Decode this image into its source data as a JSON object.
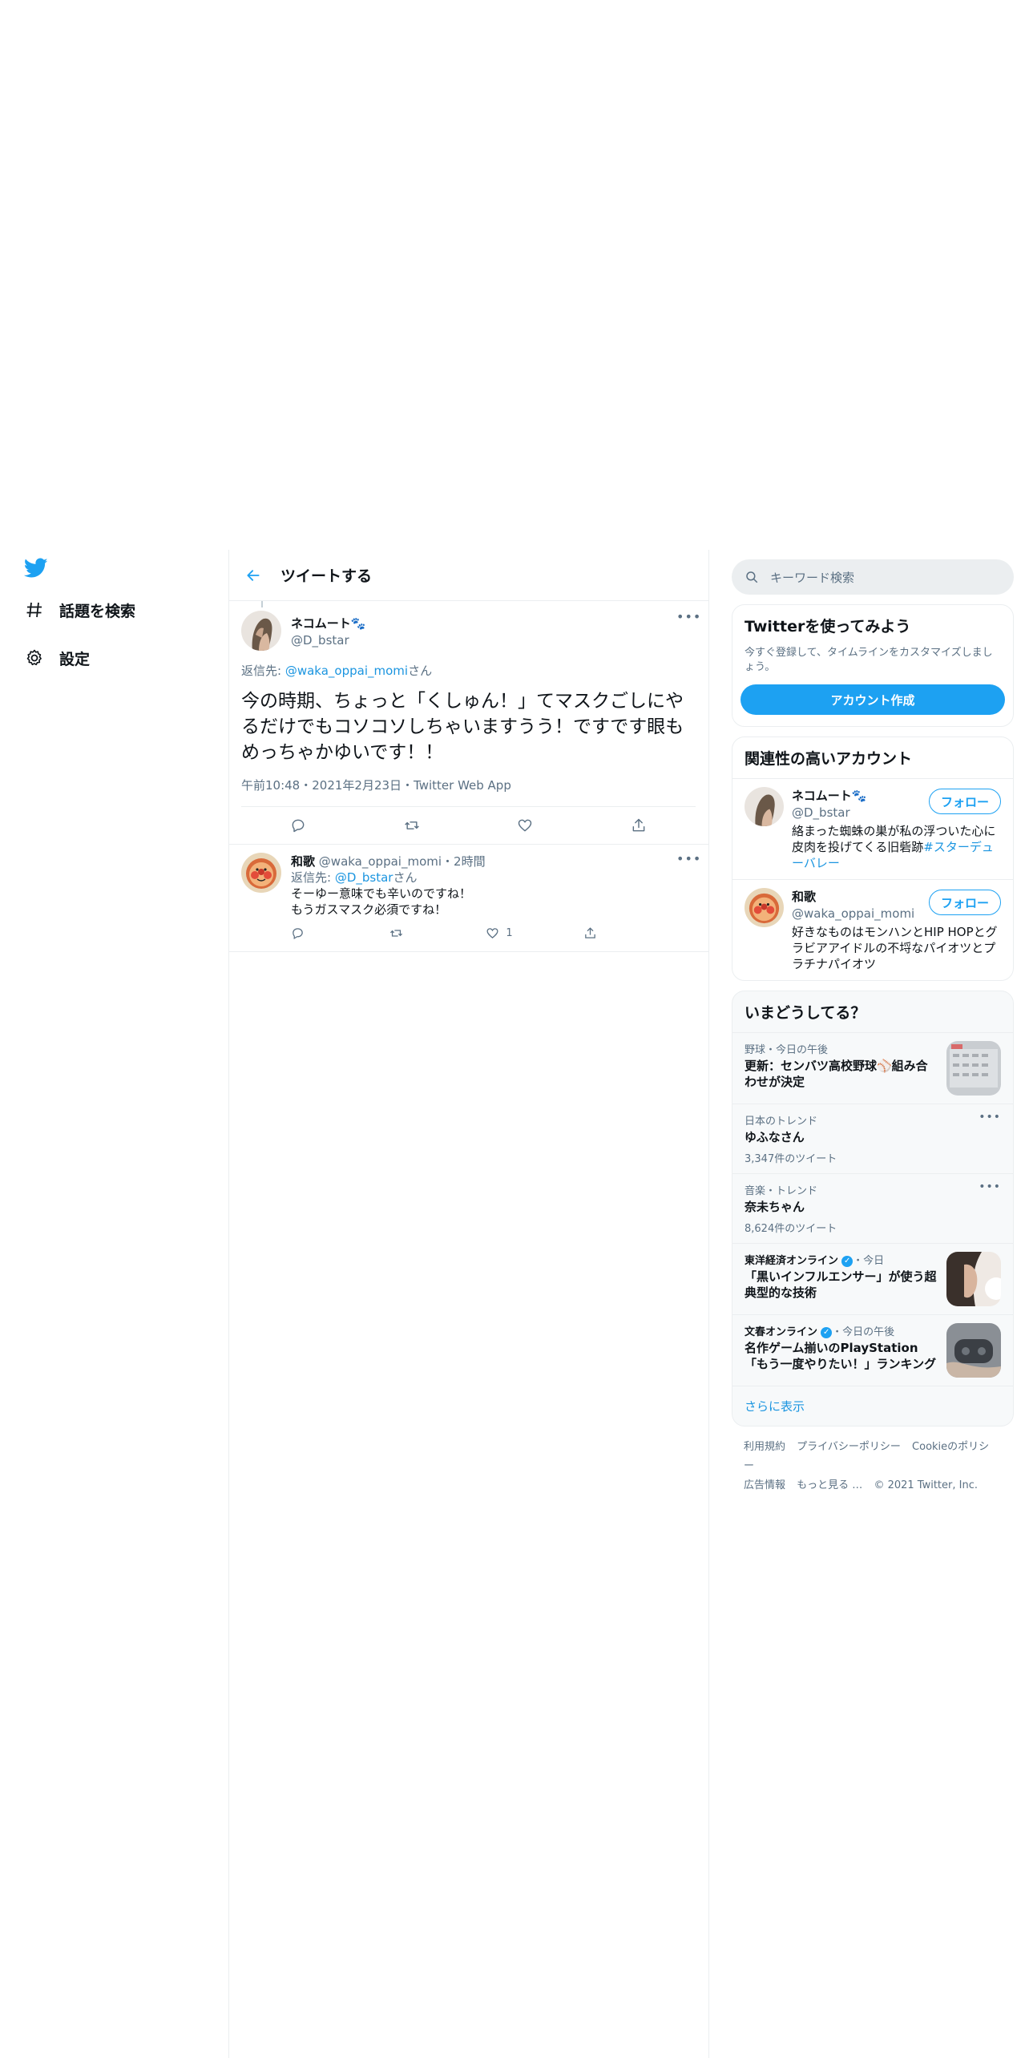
{
  "nav": {
    "logo": "twitter-bird-icon",
    "items": [
      {
        "label": "話題を検索",
        "icon": "hashtag-icon"
      },
      {
        "label": "設定",
        "icon": "gear-icon"
      }
    ]
  },
  "header": {
    "title": "ツイートする"
  },
  "focal_tweet": {
    "name": "ネコムート🐾",
    "handle": "@D_bstar",
    "reply_prefix": "返信先: ",
    "reply_handle": "@waka_oppai_momi",
    "reply_suffix": "さん",
    "text": "今の時期、ちょっと「くしゅん！」てマスクごしにやるだけでもコソコソしちゃいますうう！ですです眼もめっちゃかゆいです！！",
    "meta": "午前10:48・2021年2月23日・Twitter Web App"
  },
  "reply": {
    "name": "和歌",
    "handle": "@waka_oppai_momi",
    "time": "・2時間",
    "reply_prefix": "返信先: ",
    "reply_handle": "@D_bstar",
    "reply_suffix": "さん",
    "line1": "そーゆー意味でも辛いのですね！",
    "line2": "もうガスマスク必須ですね！",
    "like_count": "1"
  },
  "search": {
    "placeholder": "キーワード検索"
  },
  "signup": {
    "title": "Twitterを使ってみよう",
    "subtitle": "今すぐ登録して、タイムラインをカスタマイズしましょう。",
    "button": "アカウント作成"
  },
  "related": {
    "title": "関連性の高いアカウント",
    "follow_label": "フォロー",
    "accounts": [
      {
        "name": "ネコムート🐾",
        "handle": "@D_bstar",
        "bio1": "絡まった蜘蛛の巣が私の浮ついた心に皮肉を投げてくる旧砦跡",
        "bio_tag": "#スターデューバレー"
      },
      {
        "name": "和歌",
        "handle": "@waka_oppai_momi",
        "bio1": "好きなものはモンハンとHIP HOPとグラビアアイドルの不埒なパイオツとプラチナパイオツ"
      }
    ]
  },
  "trends": {
    "title": "いまどうしてる？",
    "items": [
      {
        "meta": "野球・今日の午後",
        "title": "更新：センバツ高校野球⚾組み合わせが決定",
        "has_thumb": true
      },
      {
        "meta": "日本のトレンド",
        "title": "ゆふなさん",
        "count": "3,347件のツイート"
      },
      {
        "meta": "音楽・トレンド",
        "title": "奈未ちゃん",
        "count": "8,624件のツイート"
      },
      {
        "source": "東洋経済オンライン",
        "meta": "・今日",
        "title": "「黒いインフルエンサー」が使う超典型的な技術",
        "has_thumb": true
      },
      {
        "source": "文春オンライン",
        "meta": "・今日の午後",
        "title": "名作ゲーム揃いのPlayStation「もう一度やりたい！」ランキング",
        "has_thumb": true
      }
    ],
    "show_more": "さらに表示"
  },
  "footer": {
    "links": [
      "利用規約",
      "プライバシーポリシー",
      "Cookieのポリシー",
      "広告情報",
      "もっと見る …"
    ],
    "copyright": "© 2021 Twitter, Inc."
  },
  "colors": {
    "accent": "#1da1f2",
    "link": "#1b95e0",
    "muted": "#5b7083",
    "border": "#ebeef0"
  }
}
